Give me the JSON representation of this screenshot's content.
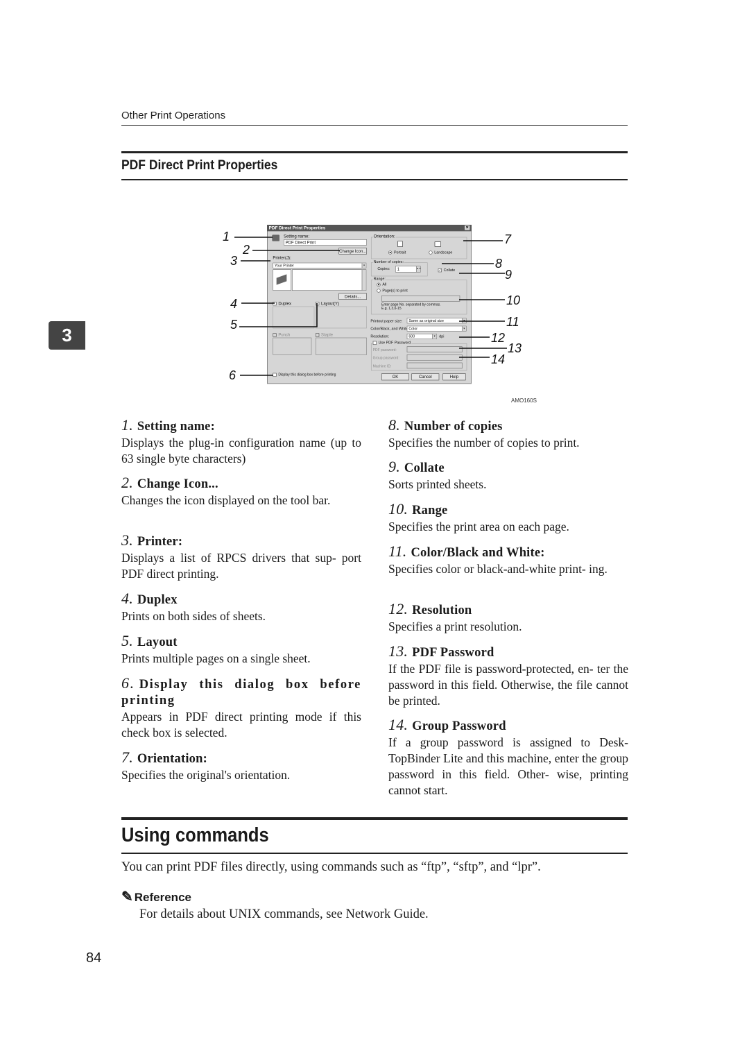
{
  "header": {
    "running_title": "Other Print Operations",
    "chapter_tab": "3",
    "page_number": "84"
  },
  "section": {
    "title": "PDF Direct Print Properties"
  },
  "dialog": {
    "title": "PDF Direct Print Properties",
    "close": "✕",
    "setting_name_label": "Setting name:",
    "setting_name_value": "PDF Direct Print",
    "change_icon": "Change Icon...",
    "printer_label": "Printer(J):",
    "printer_value": "Your Printer",
    "details": "Details...",
    "duplex": "Duplex",
    "layout": "Layout(Y)",
    "punch": "Punch",
    "staple": "Staple",
    "display_dialog": "Display this dialog box before printing",
    "orientation_label": "Orientation:",
    "portrait": "Portrait",
    "landscape": "Landscape",
    "copies_group": "Number of copies:",
    "copies_label": "Copies:",
    "copies_value": "1",
    "collate": "Collate",
    "range_label": "Range:",
    "all": "All",
    "pages": "Page(s) to print",
    "range_hint1": "Enter page No. separated by commas.",
    "range_hint2": "E.g. 1,3,6-15",
    "paper_size_label": "Printout paper size:",
    "paper_size_value": "Same as original size",
    "color_label": "Color/Black, and White:",
    "color_value": "Color",
    "resolution_label": "Resolution:",
    "resolution_value": "600",
    "dpi": "dpi",
    "use_pdf_password": "Use PDF Password",
    "pdf_password": "PDF password:",
    "group_password": "Group password:",
    "machine_id": "Machine ID:",
    "ok": "OK",
    "cancel": "Cancel",
    "help": "Help"
  },
  "callouts": [
    "1",
    "2",
    "3",
    "4",
    "5",
    "6",
    "7",
    "8",
    "9",
    "10",
    "11",
    "12",
    "13",
    "14"
  ],
  "figure_code": "AMO160S",
  "items": [
    {
      "num": "1.",
      "title": "Setting name:",
      "desc": "Displays the plug-in configuration name (up to 63 single byte characters)"
    },
    {
      "num": "2.",
      "title": "Change Icon...",
      "desc": "Changes the icon displayed on the tool bar."
    },
    {
      "num": "3.",
      "title": "Printer:",
      "desc": "Displays a list of RPCS drivers that sup- port PDF direct printing."
    },
    {
      "num": "4.",
      "title": "Duplex",
      "desc": "Prints on both sides of sheets."
    },
    {
      "num": "5.",
      "title": "Layout",
      "desc": "Prints multiple pages on a single sheet."
    },
    {
      "num": "6.",
      "title": "Display this dialog box before printing",
      "desc": "Appears in PDF direct printing mode if this check box is selected."
    },
    {
      "num": "7.",
      "title": "Orientation:",
      "desc": "Specifies the original's orientation."
    },
    {
      "num": "8.",
      "title": "Number of copies",
      "desc": "Specifies the number of copies to print."
    },
    {
      "num": "9.",
      "title": "Collate",
      "desc": "Sorts printed sheets."
    },
    {
      "num": "10.",
      "title": "Range",
      "desc": "Specifies the print area on each page."
    },
    {
      "num": "11.",
      "title": "Color/Black and White:",
      "desc": "Specifies color or black-and-white print- ing."
    },
    {
      "num": "12.",
      "title": "Resolution",
      "desc": "Specifies a print resolution."
    },
    {
      "num": "13.",
      "title": "PDF Password",
      "desc": "If the PDF file is password-protected, en- ter the password in this field. Otherwise, the file cannot be printed."
    },
    {
      "num": "14.",
      "title": "Group Password",
      "desc": "If a group password is assigned to Desk- TopBinder Lite and this machine, enter the group password in this field. Other- wise, printing cannot start."
    }
  ],
  "using_commands": {
    "title": "Using commands",
    "body": "You can print PDF files directly, using commands such as “ftp”, “sftp”, and “lpr”.",
    "reference_label": "Reference",
    "reference_icon": "pencil-icon",
    "reference_text": "For details about UNIX commands, see Network Guide."
  }
}
